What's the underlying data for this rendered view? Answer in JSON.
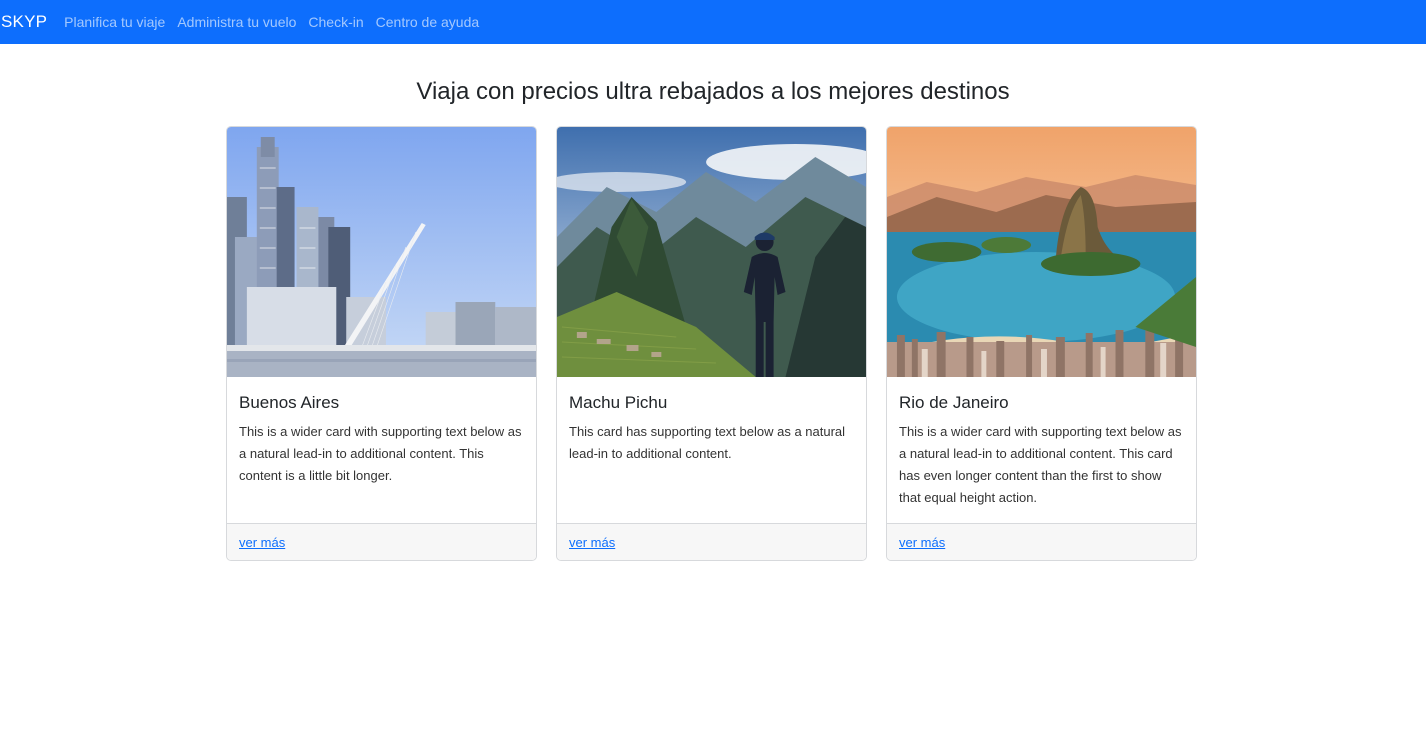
{
  "navbar": {
    "brand": "SKYP",
    "links": [
      "Planifica tu viaje",
      "Administra tu vuelo",
      "Check-in",
      "Centro de ayuda"
    ],
    "bg_color": "#0d6efd"
  },
  "main": {
    "title": "Viaja con precios ultra rebajados a los mejores destinos",
    "cards": [
      {
        "image": "buenos-aires-skyline-bridge",
        "title": "Buenos Aires",
        "text": "This is a wider card with supporting text below as a natural lead-in to additional content. This content is a little bit longer.",
        "link": "ver más"
      },
      {
        "image": "machu-picchu-mountains-hiker",
        "title": "Machu Pichu",
        "text": "This card has supporting text below as a natural lead-in to additional content.",
        "link": "ver más"
      },
      {
        "image": "rio-de-janeiro-bay-sugarloaf",
        "title": "Rio de Janeiro",
        "text": "This is a wider card with supporting text below as a natural lead-in to additional content. This card has even longer content than the first to show that equal height action.",
        "link": "ver más"
      }
    ]
  }
}
